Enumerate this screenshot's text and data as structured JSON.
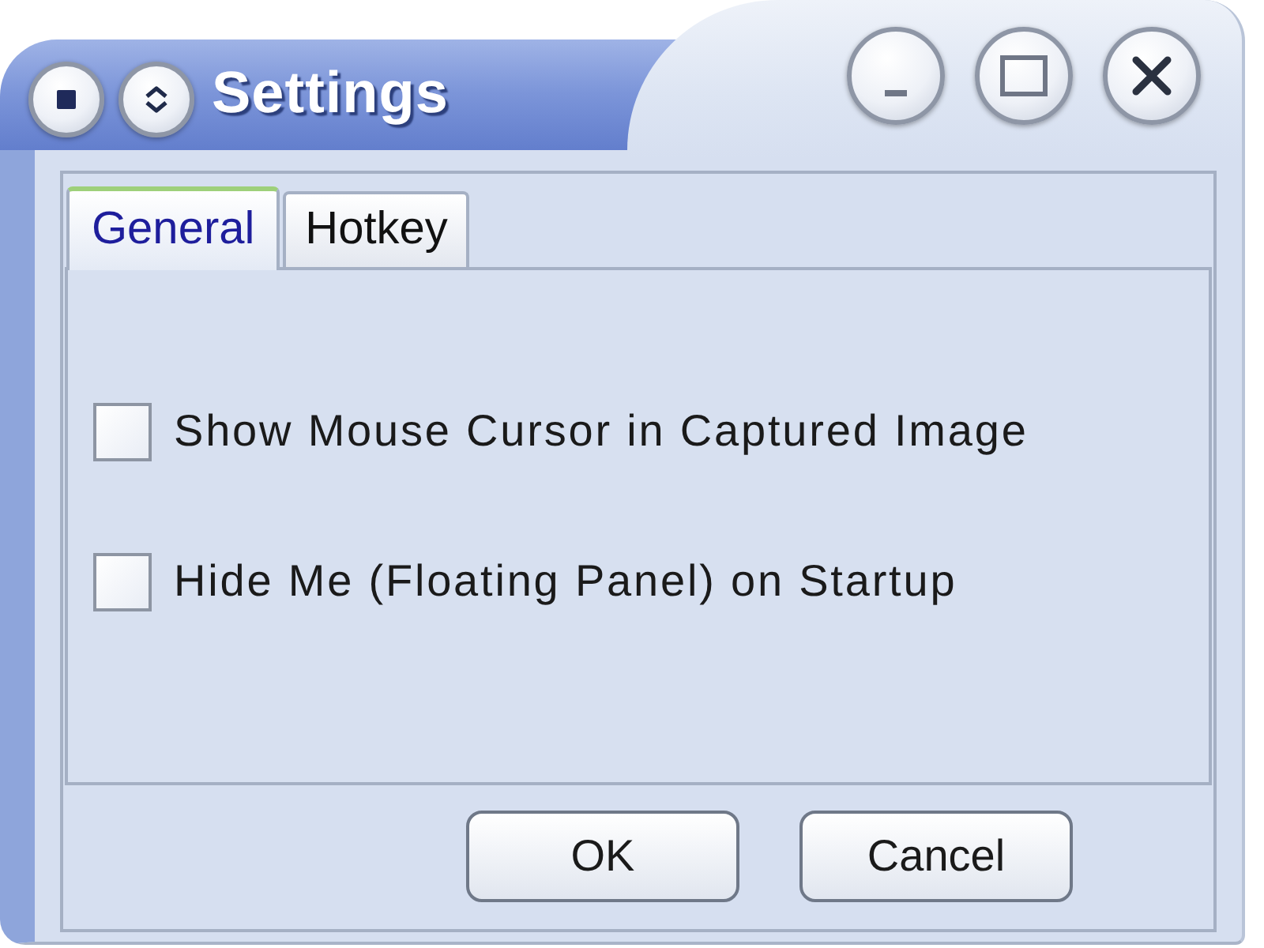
{
  "window": {
    "title": "Settings"
  },
  "tabs": [
    {
      "label": "General",
      "selected": true
    },
    {
      "label": "Hotkey",
      "selected": false
    }
  ],
  "options": [
    {
      "label": "Show Mouse Cursor in Captured Image",
      "checked": false
    },
    {
      "label": "Hide Me (Floating Panel) on Startup",
      "checked": false
    }
  ],
  "buttons": [
    "OK",
    "Cancel"
  ]
}
